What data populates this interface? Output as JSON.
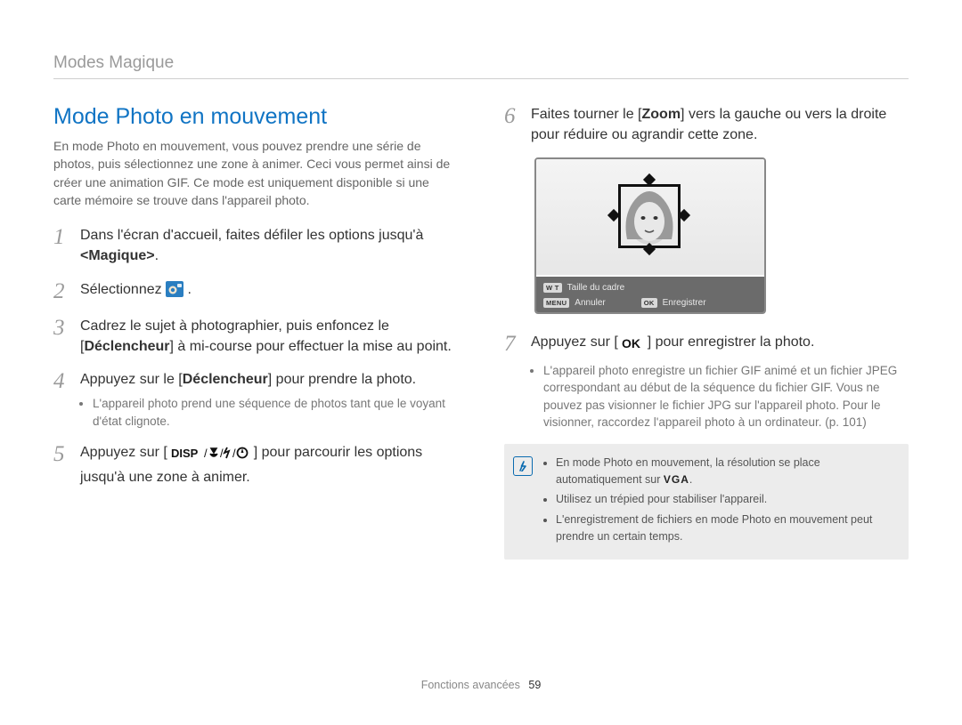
{
  "breadcrumb": "Modes Magique",
  "section_title": "Mode Photo en mouvement",
  "intro": "En mode Photo en mouvement, vous pouvez prendre une série de photos, puis sélectionnez une zone à animer. Ceci vous permet ainsi de créer une animation GIF. Ce mode est uniquement disponible si une carte mémoire se trouve dans l'appareil photo.",
  "steps": {
    "s1_a": "Dans l'écran d'accueil, faites défiler les options jusqu'à ",
    "s1_b": "<Magique>",
    "s1_c": ".",
    "s2_a": "Sélectionnez ",
    "s2_b": ".",
    "s3_a": "Cadrez le sujet à photographier, puis enfoncez le [",
    "s3_b": "Déclencheur",
    "s3_c": "] à mi-course pour effectuer la mise au point.",
    "s4_a": "Appuyez sur le [",
    "s4_b": "Déclencheur",
    "s4_c": "] pour prendre la photo.",
    "s4_note": "L'appareil photo prend une séquence de photos tant que le voyant d'état clignote.",
    "s5_a": "Appuyez sur [",
    "s5_b": "] pour parcourir les options jusqu'à une zone à animer.",
    "s6_a": "Faites tourner le [",
    "s6_b": "Zoom",
    "s6_c": "] vers la gauche ou vers la droite pour réduire ou agrandir cette zone.",
    "s7_a": "Appuyez sur [",
    "s7_b": "] pour enregistrer la photo.",
    "s7_note": "L'appareil photo enregistre un fichier GIF animé et un fichier JPEG correspondant au début de la séquence du fichier GIF. Vous ne pouvez pas visionner le fichier JPG sur l'appareil photo. Pour le visionner, raccordez l'appareil photo à un ordinateur. (p. 101)"
  },
  "lcd": {
    "wt": "W  T",
    "frame_size": "Taille du cadre",
    "menu": "MENU",
    "cancel": "Annuler",
    "ok": "OK",
    "save": "Enregistrer"
  },
  "tips": {
    "t1_a": "En mode Photo en mouvement, la résolution se place automatiquement sur ",
    "t1_b": ".",
    "t2": "Utilisez un trépied pour stabiliser l'appareil.",
    "t3": "L'enregistrement de fichiers en mode Photo en mouvement peut prendre un certain temps."
  },
  "footer": {
    "label": "Fonctions avancées",
    "page": "59"
  }
}
